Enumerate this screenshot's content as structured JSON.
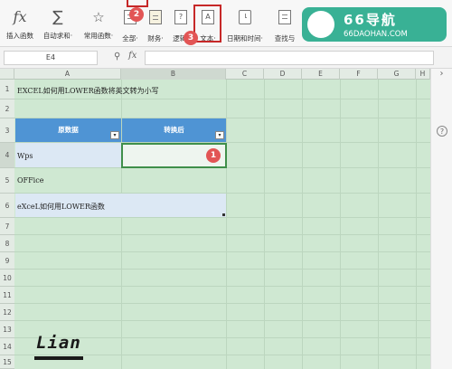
{
  "ribbon": {
    "buttons": [
      {
        "label": "插入函数",
        "icon": "fx-icon"
      },
      {
        "label": "自动求和·",
        "icon": "sigma-icon"
      },
      {
        "label": "常用函数·",
        "icon": "star-function-icon"
      },
      {
        "label": "全部·",
        "icon": "book-icon"
      },
      {
        "label": "财务·",
        "icon": "finance-icon"
      },
      {
        "label": "逻辑·",
        "icon": "logic-icon"
      },
      {
        "label": "文本·",
        "icon": "text-function-icon"
      },
      {
        "label": "日期和时间·",
        "icon": "clock-icon"
      },
      {
        "label": "查找与",
        "icon": "lookup-icon"
      }
    ],
    "glyphs": {
      "fx": "fx",
      "sigma": "∑",
      "star": "☆"
    },
    "markers": {
      "tab_marker": "2",
      "text_marker": "3"
    }
  },
  "formula_bar": {
    "cell_ref": "E4",
    "zoom_glyph": "⚲",
    "fx_glyph": "fx",
    "value": ""
  },
  "grid": {
    "columns": [
      "A",
      "B",
      "C",
      "D",
      "E",
      "F",
      "G",
      "H"
    ],
    "rows": [
      "1",
      "2",
      "3",
      "4",
      "5",
      "6",
      "7",
      "8",
      "9",
      "10",
      "11",
      "12",
      "13",
      "14",
      "15"
    ],
    "title_text": "EXCEL如何用LOWER函数将英文转为小写",
    "header_col_a": "原数据",
    "header_col_b": "转换后",
    "dropdown_glyph": "▾",
    "data_rows": [
      "Wps",
      "OFFice",
      "eXceL如何用LOWER函数"
    ],
    "cell_marker": "1"
  },
  "rightbar": {
    "expand_glyph": "›",
    "help_glyph": "?"
  },
  "watermark": {
    "title": "66导航",
    "url": "66DAOHAN.COM"
  },
  "signature": {
    "text": "Lian"
  }
}
